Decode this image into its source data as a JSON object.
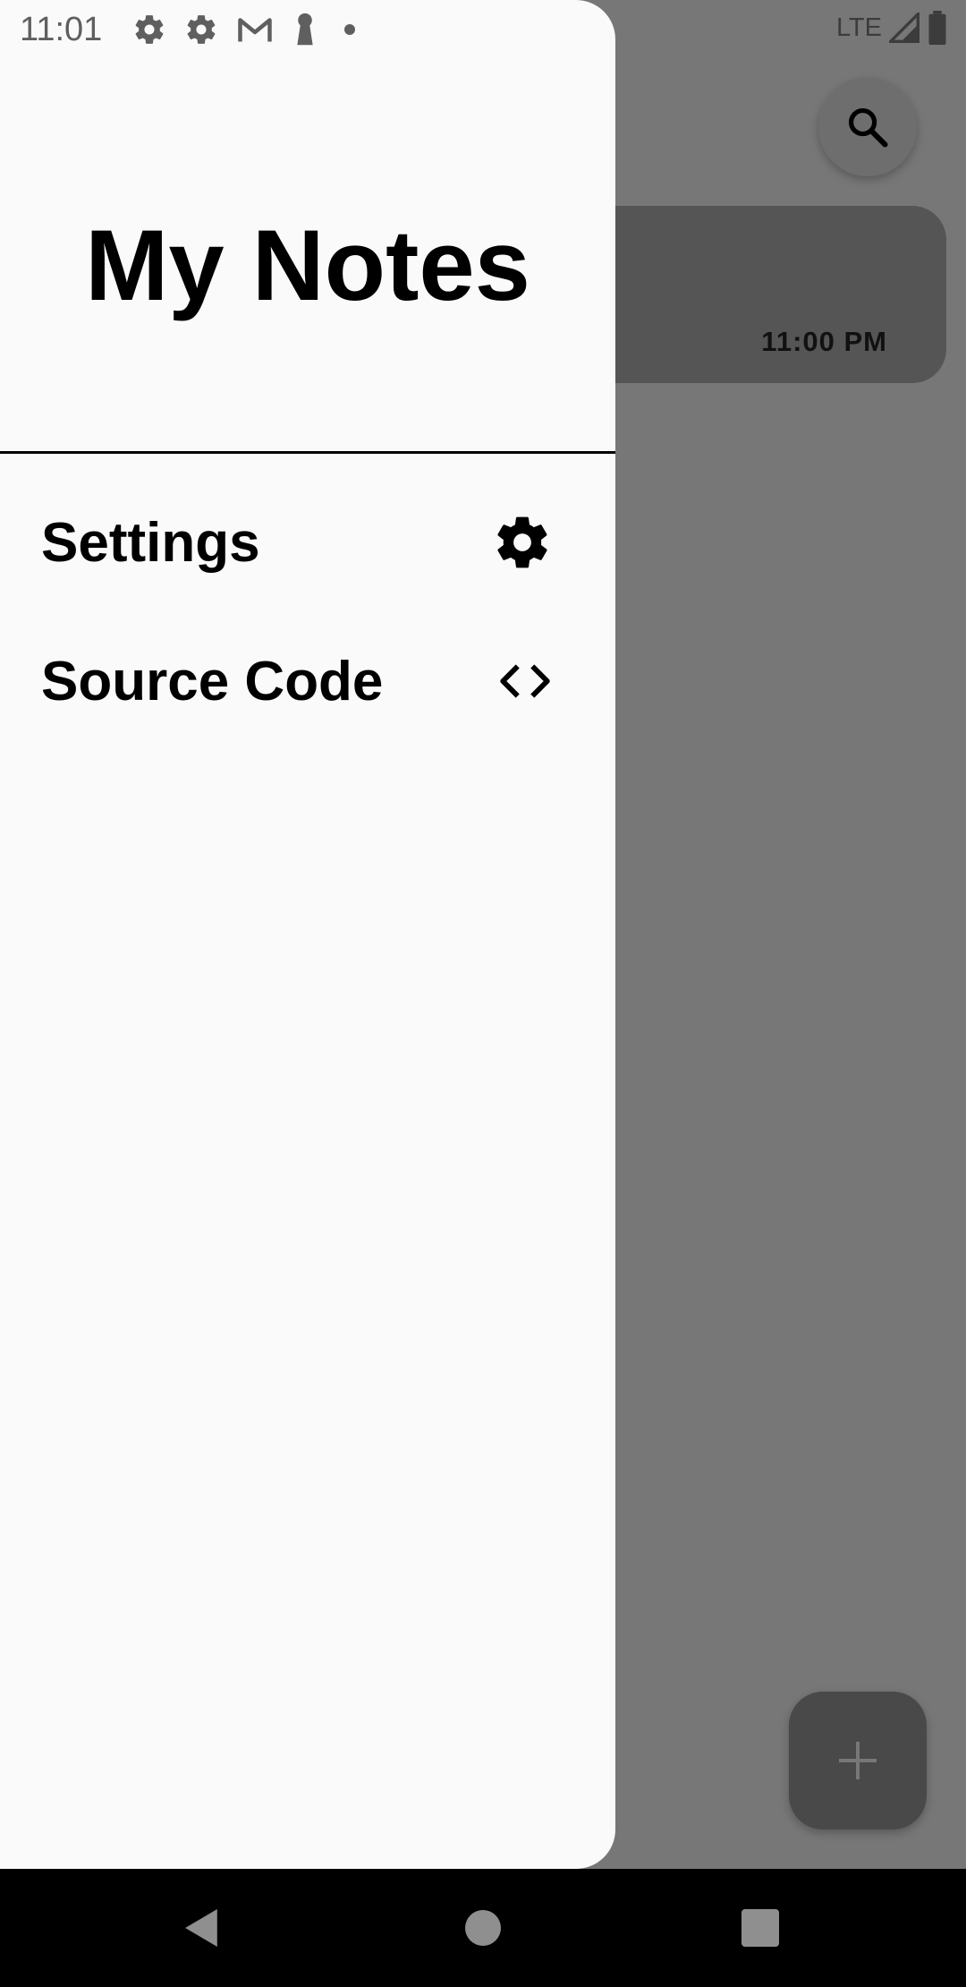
{
  "status_bar": {
    "time": "11:01",
    "network": "LTE",
    "icons": [
      "settings-icon",
      "settings-icon",
      "gmail-icon",
      "keyhole-icon",
      "dot-icon",
      "signal-icon",
      "battery-icon"
    ]
  },
  "drawer": {
    "title": "My Notes",
    "items": [
      {
        "label": "Settings",
        "icon": "gear-icon"
      },
      {
        "label": "Source Code",
        "icon": "code-icon"
      }
    ]
  },
  "background": {
    "note_card": {
      "time": "11:00 PM"
    },
    "search_button": {
      "icon": "search-icon"
    },
    "add_button": {
      "icon": "plus-icon"
    }
  },
  "nav_bar": {
    "buttons": [
      "back",
      "home",
      "recents"
    ]
  },
  "colors": {
    "drawer_bg": "#fafafa",
    "scrim": "#777777",
    "note_card": "#555555",
    "fab": "#494949",
    "nav_bar": "#000000"
  }
}
